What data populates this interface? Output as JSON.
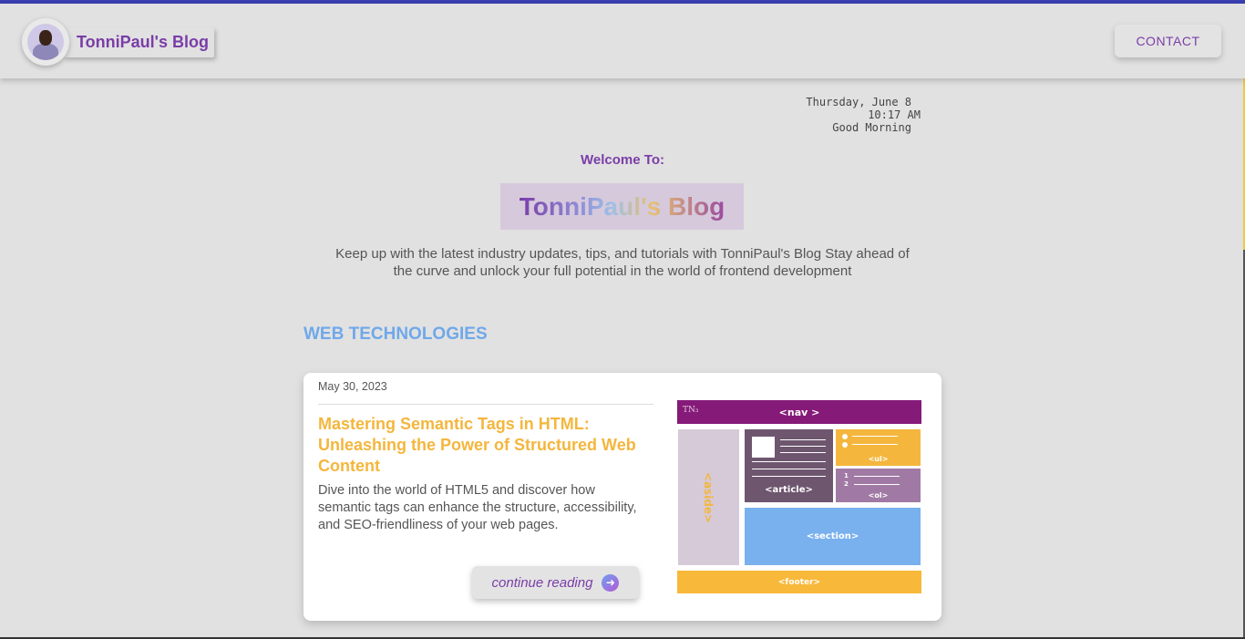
{
  "header": {
    "brand_name": "TonniPaul's Blog",
    "contact_label": "CONTACT"
  },
  "clock": {
    "date": "Thursday, June 8",
    "time": "10:17 AM",
    "greeting": "Good Morning"
  },
  "hero": {
    "welcome": "Welcome To:",
    "title": "TonniPaul's Blog",
    "tagline": "Keep up with the latest industry updates, tips, and tutorials with TonniPaul's Blog Stay ahead of the curve and unlock your full potential in the world of frontend development"
  },
  "section": {
    "title": "WEB TECHNOLOGIES"
  },
  "post": {
    "date": "May 30, 2023",
    "title": "Mastering Semantic Tags in HTML: Unleashing the Power of Structured Web Content",
    "excerpt": "Dive into the world of HTML5 and discover how semantic tags can enhance the structure, accessibility, and SEO-friendliness of your web pages.",
    "read_label": "continue reading",
    "read_icon": "arrow-right-icon",
    "diagram": {
      "logo": "TN₃",
      "nav": "<nav >",
      "aside": "<aside>",
      "article": "<article>",
      "ul": "<ul>",
      "ol_1": "1",
      "ol_2": "2",
      "ol": "<ol>",
      "section": "<section>",
      "footer": "<footer>"
    }
  },
  "colors": {
    "accent_purple": "#7a3da8",
    "accent_yellow": "#f4b63d",
    "accent_blue": "#6fa8ea",
    "background": "#e1e1e1",
    "top_strip": "#3a3fb0"
  }
}
